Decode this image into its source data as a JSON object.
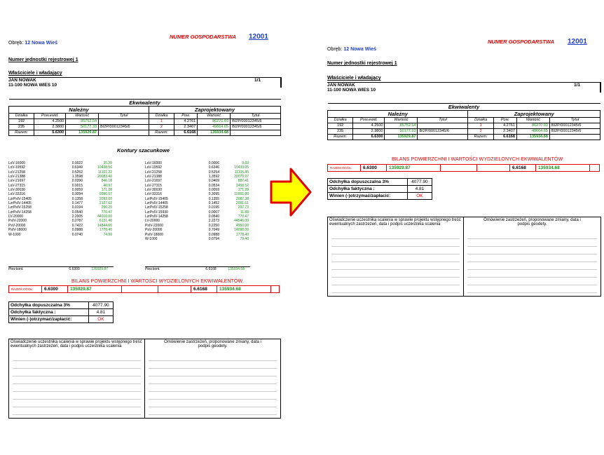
{
  "doc": {
    "header_label": "NUMER GOSPODARSTWA",
    "farm_number": "12001",
    "obreb_label": "Obręb:",
    "obreb_value": "12 Nowa Wieś",
    "unit_label": "Numer jednostki rejestrowej 1",
    "owners_label": "Właściciele i władający",
    "owner_name": "JAN NOWAK",
    "owner_address": "11-100 NOWA WIES 10",
    "share": "1/1"
  },
  "ekwiwalenty": {
    "title": "Ekwiwalenty",
    "nalezny": "Należny",
    "zaprojektowany": "Zaprojektowany",
    "columns_left": [
      "Działka",
      "Pow.ewid.",
      "Wartość",
      "Tytuł"
    ],
    "columns_right": [
      "Działka",
      "Pow.",
      "Wartość",
      "Tytuł"
    ],
    "rows": [
      {
        "dz1": "192",
        "pow1": "4.2500",
        "war1": "85752.54",
        "tyt1": "",
        "dz2": "1",
        "pow2": "4.2761",
        "war2": "86270.03",
        "tyt2": "BI2P/00012345/6"
      },
      {
        "dz1": "235",
        "pow1": "2.3800",
        "war1": "50177.33",
        "tyt1": "BI2P/00012345/6",
        "dz2": "2",
        "pow2": "2.3407",
        "war2": "49664.65",
        "tyt2": "BI2P/00012345/6"
      }
    ],
    "razem_label": "Razem:",
    "razem_pow1": "6.6300",
    "razem_war1": "135929.87",
    "razem_pow2": "6.6168",
    "razem_war2": "135934.68"
  },
  "kontury": {
    "title": "Kontury szacunkowe",
    "left": [
      [
        "LsV-16000",
        "0.0022",
        "35.20"
      ],
      [
        "LsV-19592",
        "0.6349",
        "10438.56"
      ],
      [
        "LsV-21258",
        "0.5252",
        "11101.22"
      ],
      [
        "LsV-21388",
        "1.3598",
        "20083.40"
      ],
      [
        "LsV-21697",
        "0.0390",
        "846.18"
      ],
      [
        "LsV-27315",
        "0.0015",
        "40.97"
      ],
      [
        "LsV-30030",
        "0.0059",
        "171.28"
      ],
      [
        "LsV-33316",
        "0.3094",
        "9996.57"
      ],
      [
        "LzrPsIV-15405",
        "0.1358",
        "2092.00"
      ],
      [
        "LzrPsIV-14405",
        "0.1477",
        "2127.62"
      ],
      [
        "LzrPsIV-15258",
        "0.0194",
        "296.20"
      ],
      [
        "LzrPsIV-14258",
        "0.0540",
        "770.47"
      ],
      [
        "LV-20000",
        "2.2005",
        "44010.00"
      ],
      [
        "PsIV-22000",
        "0.2787",
        "6131.40"
      ],
      [
        "PsV-20000",
        "0.7422",
        "14844.00"
      ],
      [
        "PsIV-18000",
        "0.0988",
        "1778.40"
      ],
      [
        "W-1000",
        "0.0740",
        "74.00"
      ]
    ],
    "right": [
      [
        "LsV-16000",
        "0.0006",
        "9.60"
      ],
      [
        "LsV-19592",
        "0.6346",
        "10433.05"
      ],
      [
        "LsV-21258",
        "0.5254",
        "11105.45"
      ],
      [
        "LsV-21388",
        "1.3592",
        "20070.97"
      ],
      [
        "LsV-21697",
        "0.0409",
        "887.41"
      ],
      [
        "LsV-27315",
        "0.0534",
        "1458.52"
      ],
      [
        "LsV-30030",
        "0.0059",
        "171.28"
      ],
      [
        "LsV-33316",
        "0.3095",
        "10001.80"
      ],
      [
        "LzrPsIV-15405",
        "0.1355",
        "2087.38"
      ],
      [
        "LzrPsIV-14405",
        "0.1452",
        "2091.61"
      ],
      [
        "LzrPsIV-15258",
        "0.0195",
        "297.73"
      ],
      [
        "LzrPsIV-15930",
        "0.0007",
        "11.88"
      ],
      [
        "LzrPsIV-14258",
        "0.0540",
        "770.47"
      ],
      [
        "LV-20000",
        "2.2273",
        "44546.00"
      ],
      [
        "PsIV-22000",
        "0.2250",
        "4950.00"
      ],
      [
        "PsV-20000",
        "0.7049",
        "14098.00"
      ],
      [
        "PsIV-18000",
        "0.0988",
        "1778.40"
      ],
      [
        "W-1000",
        "0.0794",
        "79.40"
      ]
    ],
    "sum_label": "Pow.kont.",
    "sum_left_pow": "6.6300",
    "sum_left_war": "135929.87",
    "sum_right_pow": "6.6168",
    "sum_right_war": "135934.68"
  },
  "bilans": {
    "title": "BILANS POWIERZCHNI I WARTOŚCI WYDZIELONYCH EKWIWALENTÓW",
    "razem_label": "RAZEM OGÓŁ:",
    "pow_left": "6.6300",
    "war_left": "135929.87",
    "pow_right": "6.6168",
    "war_right": "135934.68"
  },
  "odchylka": {
    "dopuszczalna_label": "Odchyłka dopuszczalna 3%",
    "dopuszczalna_value": "4077.90",
    "faktyczna_label": "Odchyłka faktyczna :",
    "faktyczna_value": "4.81",
    "winien_label": "Winien (-)otrzymać/zapłacić:",
    "winien_value": "OK"
  },
  "signature": {
    "left_text": "Oświadczenie uczestnika scalenia w sprawie projektu wstępnego treść ewentualnych zastrzeżeń, data i podpis uczestnika scalenia",
    "right_text": "Omówienie zastrzeżeń, proponowane zmiany, data i podpis geodety."
  },
  "colors": {
    "red": "#e00000",
    "green": "#1b8f1b",
    "blue": "#1f3fbf",
    "arrow_fill": "#ffff00",
    "arrow_stroke": "#e00000"
  }
}
